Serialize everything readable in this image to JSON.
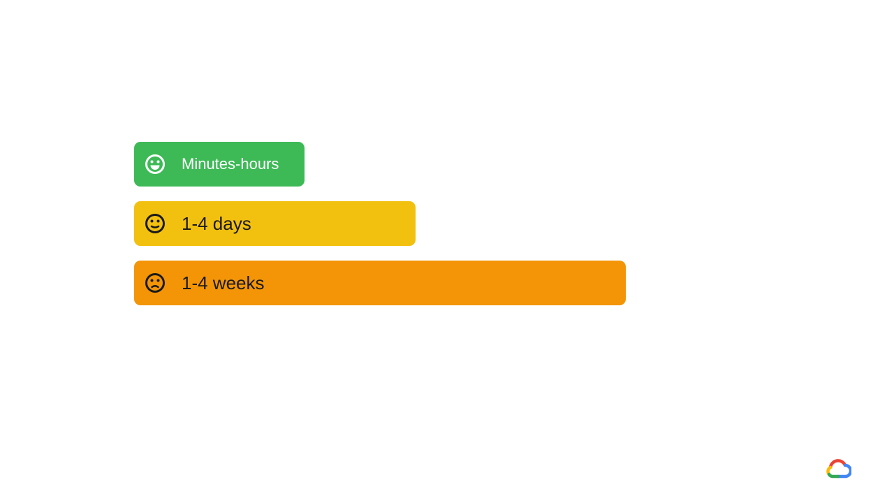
{
  "bars": [
    {
      "label": "Minutes-hours",
      "icon": "smiley-happy-icon",
      "background": "#3dba56",
      "text_color": "#ffffff"
    },
    {
      "label": "1-4 days",
      "icon": "smiley-neutral-icon",
      "background": "#f2c00f",
      "text_color": "#1a1a1a"
    },
    {
      "label": "1-4 weeks",
      "icon": "smiley-sad-icon",
      "background": "#f39507",
      "text_color": "#1a1a1a"
    }
  ],
  "logo": {
    "icon": "google-cloud-logo-icon",
    "colors": [
      "#ea4335",
      "#4285f4",
      "#fbbc05",
      "#34a853"
    ]
  }
}
